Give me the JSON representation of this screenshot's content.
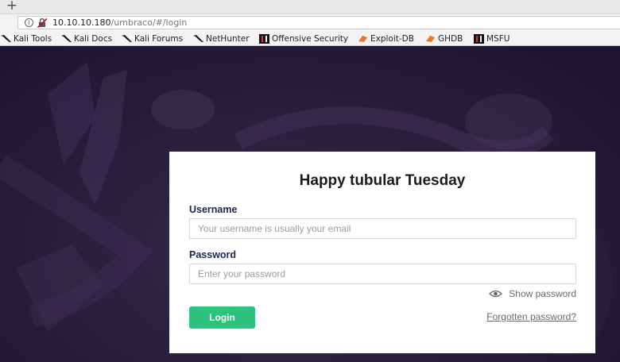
{
  "browser": {
    "new_tab_symbol": "+",
    "info_icon_glyph": "i",
    "url_host": "10.10.10.180",
    "url_path": "/umbraco/#/login"
  },
  "bookmarks": [
    {
      "label": "Kali Tools",
      "icon": "kali-dragon-icon"
    },
    {
      "label": "Kali Docs",
      "icon": "kali-dragon-icon"
    },
    {
      "label": "Kali Forums",
      "icon": "kali-dragon-icon"
    },
    {
      "label": "NetHunter",
      "icon": "kali-dragon-icon"
    },
    {
      "label": "Offensive Security",
      "icon": "offsec-icon"
    },
    {
      "label": "Exploit-DB",
      "icon": "exploitdb-icon"
    },
    {
      "label": "GHDB",
      "icon": "exploitdb-icon"
    },
    {
      "label": "MSFU",
      "icon": "offsec-icon"
    }
  ],
  "login": {
    "greeting": "Happy tubular Tuesday",
    "username_label": "Username",
    "username_placeholder": "Your username is usually your email",
    "password_label": "Password",
    "password_placeholder": "Enter your password",
    "show_password": "Show password",
    "login_button": "Login",
    "forgot_password": "Forgotten password?"
  },
  "colors": {
    "login_button": "#2bc37c",
    "label_text": "#1b264f",
    "background": "#2a1f3d"
  }
}
